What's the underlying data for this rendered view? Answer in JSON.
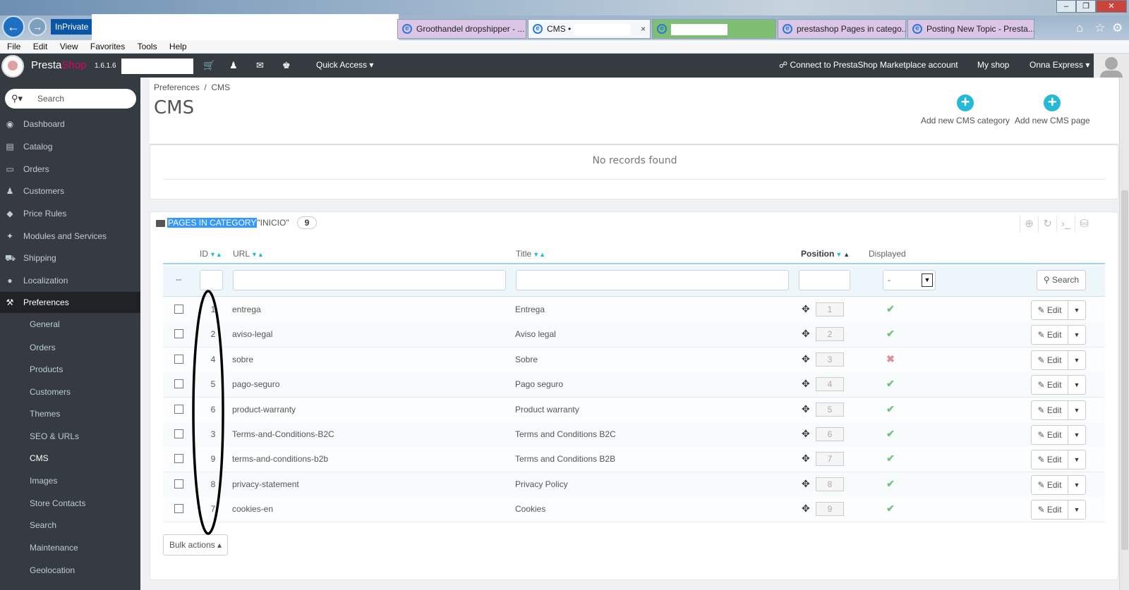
{
  "browser": {
    "inprivate_label": "InPrivate",
    "tabs": [
      {
        "label": "Groothandel dropshipper - ...",
        "state": "inactive"
      },
      {
        "label": "CMS •",
        "state": "active",
        "close": "×"
      },
      {
        "label": "",
        "state": "green"
      },
      {
        "label": "prestashop Pages in catego...",
        "state": "inactive"
      },
      {
        "label": "Posting New Topic - Presta...",
        "state": "inactive"
      }
    ],
    "menu": [
      "File",
      "Edit",
      "View",
      "Favorites",
      "Tools",
      "Help"
    ]
  },
  "header": {
    "brand_presta": "Presta",
    "brand_shop": "Shop",
    "version": "1.6.1.6",
    "quick_access": "Quick Access",
    "connect_marketplace": "Connect to PrestaShop Marketplace account",
    "my_shop": "My shop",
    "user": "Onna Express"
  },
  "sidebar": {
    "search_placeholder": "Search",
    "items": [
      {
        "label": "Dashboard",
        "icon": "dashboard-icon"
      },
      {
        "label": "Catalog",
        "icon": "book-icon"
      },
      {
        "label": "Orders",
        "icon": "credit-card-icon"
      },
      {
        "label": "Customers",
        "icon": "users-icon"
      },
      {
        "label": "Price Rules",
        "icon": "tag-icon"
      },
      {
        "label": "Modules and Services",
        "icon": "puzzle-icon"
      },
      {
        "label": "Shipping",
        "icon": "truck-icon"
      },
      {
        "label": "Localization",
        "icon": "globe-icon"
      },
      {
        "label": "Preferences",
        "icon": "wrench-icon",
        "active": true
      }
    ],
    "submenu": [
      "General",
      "Orders",
      "Products",
      "Customers",
      "Themes",
      "SEO & URLs",
      "CMS",
      "Images",
      "Store Contacts",
      "Search",
      "Maintenance",
      "Geolocation"
    ],
    "submenu_active": "CMS"
  },
  "page": {
    "breadcrumb_parent": "Preferences",
    "breadcrumb_sep": "/",
    "breadcrumb_current": "CMS",
    "title": "CMS",
    "add_category": "Add new CMS category",
    "add_page": "Add new CMS page"
  },
  "categories_panel": {
    "empty_message": "No records found"
  },
  "pages_panel": {
    "heading_selected": "PAGES IN CATEGORY",
    "heading_rest": "\"INICIO\"",
    "count": "9",
    "columns": {
      "id": "ID",
      "url": "URL",
      "title": "Title",
      "position": "Position",
      "displayed": "Displayed"
    },
    "filter_dash": "--",
    "filter_select_value": "-",
    "search_button": "Search",
    "edit_label": "Edit",
    "bulk_actions": "Bulk actions",
    "rows": [
      {
        "id": "1",
        "url": "entrega",
        "title": "Entrega",
        "position": "1",
        "displayed": true
      },
      {
        "id": "2",
        "url": "aviso-legal",
        "title": "Aviso legal",
        "position": "2",
        "displayed": true
      },
      {
        "id": "4",
        "url": "sobre",
        "title": "Sobre",
        "position": "3",
        "displayed": false
      },
      {
        "id": "5",
        "url": "pago-seguro",
        "title": "Pago seguro",
        "position": "4",
        "displayed": true
      },
      {
        "id": "6",
        "url": "product-warranty",
        "title": "Product warranty",
        "position": "5",
        "displayed": true
      },
      {
        "id": "3",
        "url": "Terms-and-Conditions-B2C",
        "title": "Terms and Conditions B2C",
        "position": "6",
        "displayed": true
      },
      {
        "id": "9",
        "url": "terms-and-conditions-b2b",
        "title": "Terms and Conditions B2B",
        "position": "7",
        "displayed": true
      },
      {
        "id": "8",
        "url": "privacy-statement",
        "title": "Privacy Policy",
        "position": "8",
        "displayed": true
      },
      {
        "id": "7",
        "url": "cookies-en",
        "title": "Cookies",
        "position": "9",
        "displayed": true
      }
    ]
  },
  "colors": {
    "sidebar_bg": "#363a41",
    "accent": "#25b9d7",
    "check": "#72c279",
    "cross": "#e08f95"
  }
}
